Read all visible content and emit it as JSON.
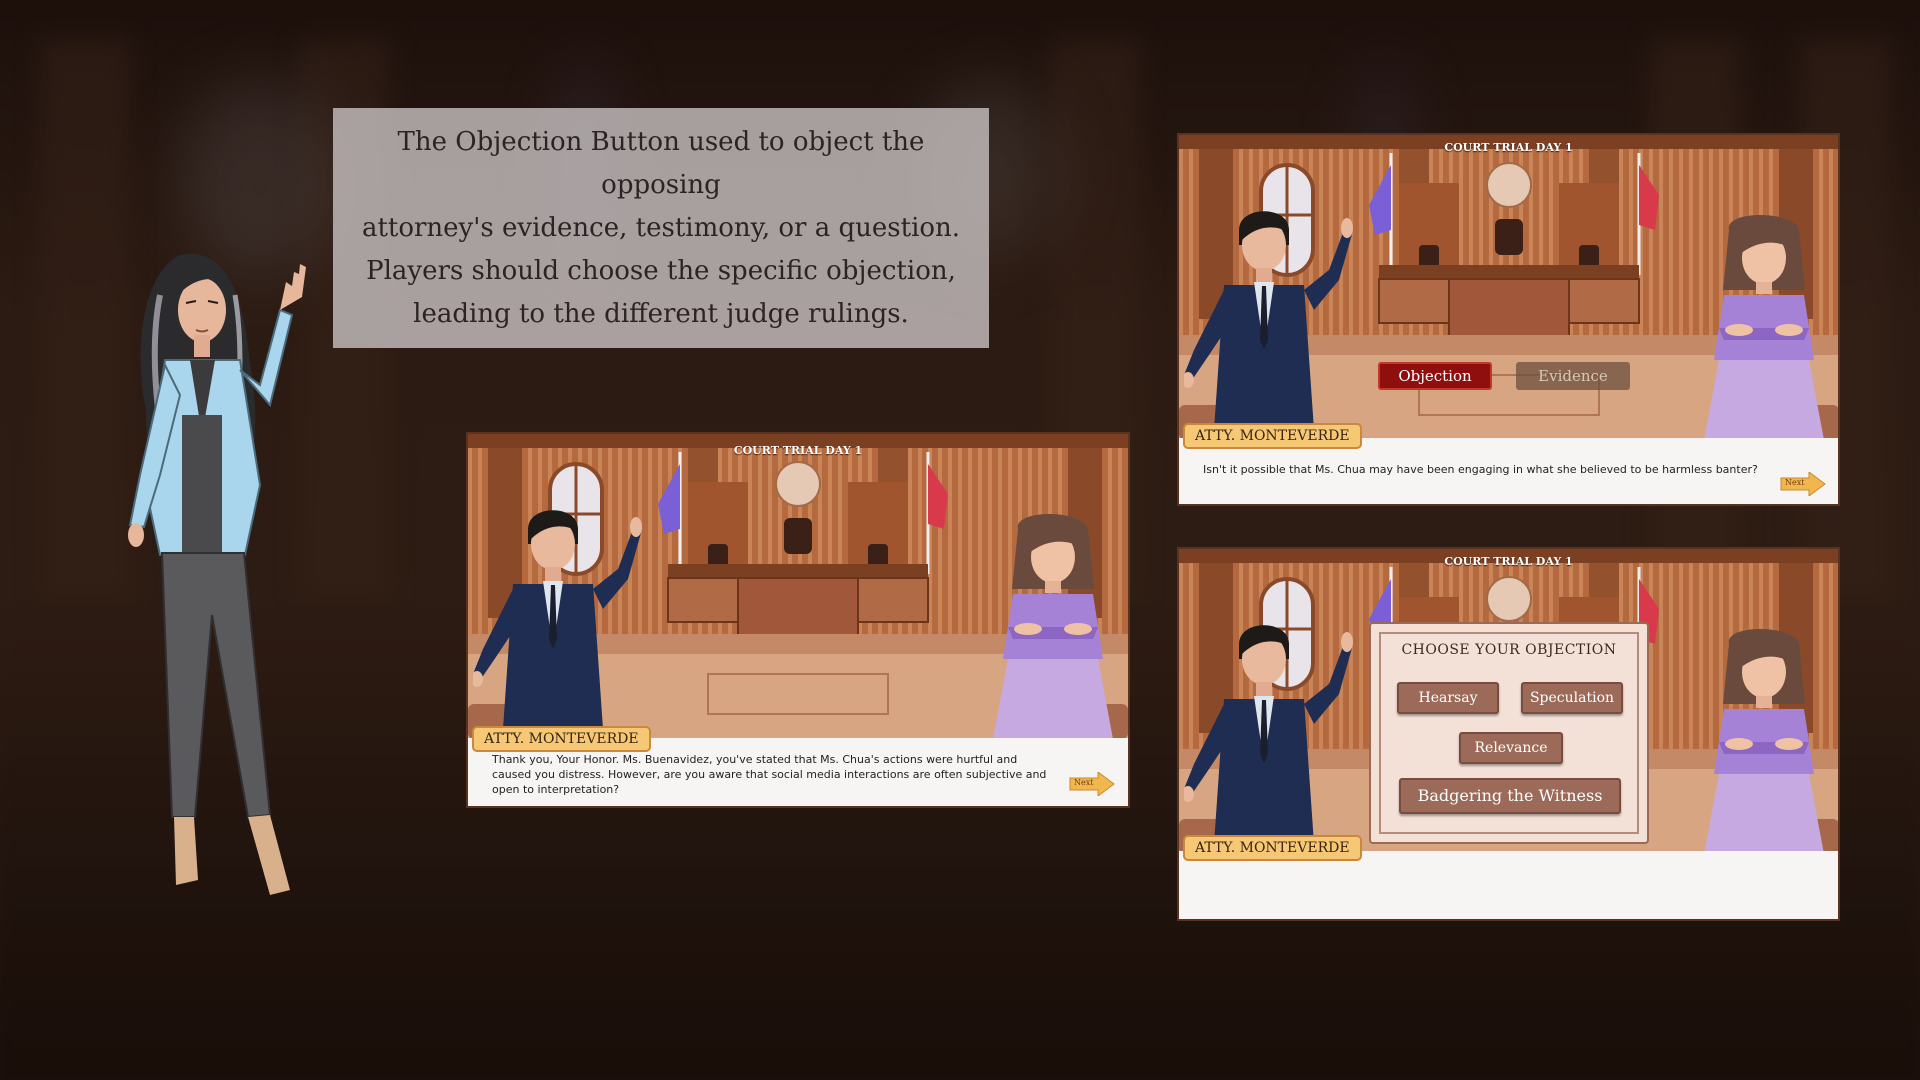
{
  "caption": {
    "line1": "The Objection Button used to object the opposing",
    "line2": "attorney's evidence, testimony, or a question.",
    "line3": "Players should choose the specific objection,",
    "line4": "leading to the different judge rulings."
  },
  "panel_dialogue": {
    "title": "COURT TRIAL DAY 1",
    "speaker": "ATTY. MONTEVERDE",
    "text_line1": "Thank you, Your Honor. Ms. Buenavidez, you've stated that Ms. Chua's actions were hurtful and",
    "text_line2": "caused you distress. However, are you aware that social media interactions are often subjective and",
    "text_line3": "open to interpretation?",
    "next_label": "Next"
  },
  "panel_objection": {
    "title": "COURT TRIAL DAY 1",
    "speaker": "ATTY. MONTEVERDE",
    "objection_label": "Objection",
    "evidence_label": "Evidence",
    "text": "Isn't it possible that Ms. Chua may have been engaging in what she believed to be harmless banter?",
    "next_label": "Next"
  },
  "panel_menu": {
    "title": "COURT TRIAL DAY 1",
    "speaker": "ATTY.  MONTEVERDE",
    "menu_heading": "CHOOSE YOUR OBJECTION",
    "options": [
      "Hearsay",
      "Speculation",
      "Relevance",
      "Badgering the Witness"
    ]
  },
  "colors": {
    "objection": "#8f0e0e",
    "nametag": "#f6c875",
    "caption_bg": "#c4bebe",
    "courtroom_wall": "#a8603c"
  }
}
